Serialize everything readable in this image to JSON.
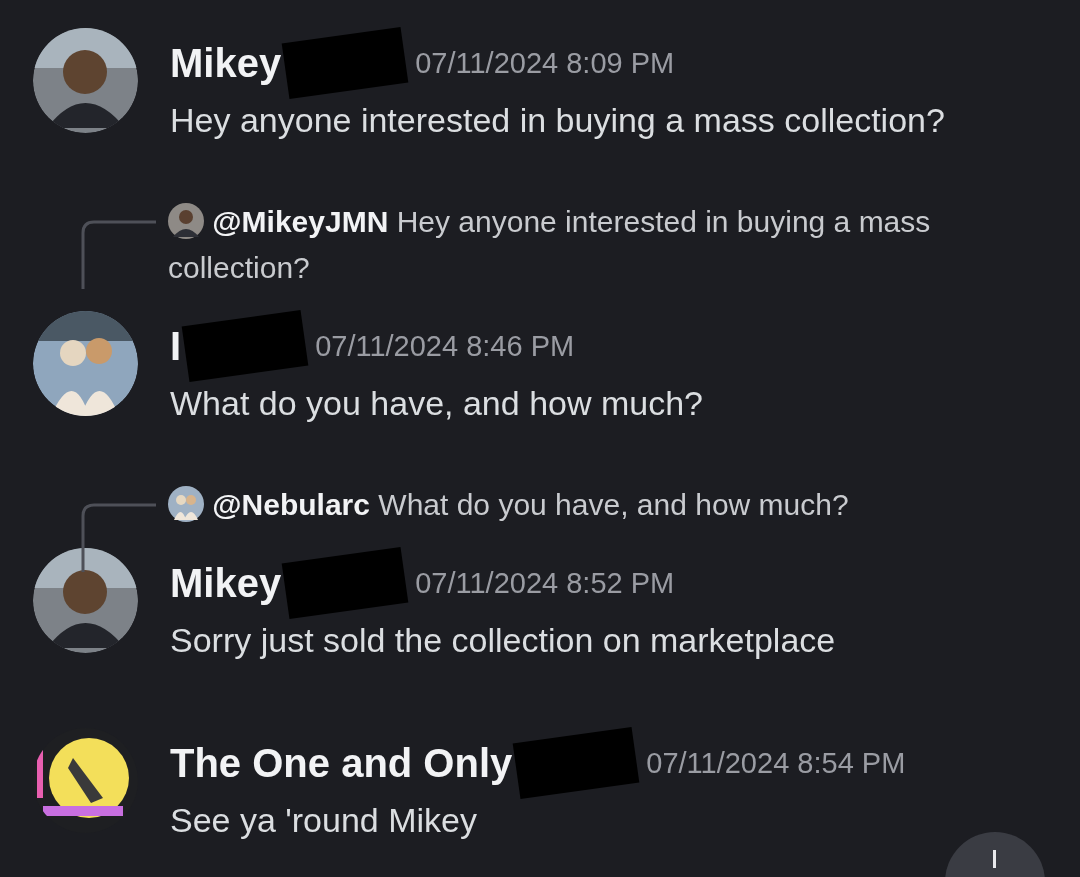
{
  "messages": [
    {
      "author": "Mikey",
      "redacted": true,
      "timestamp": "07/11/2024 8:09 PM",
      "text": "Hey anyone interested in buying a mass collection?",
      "avatar": {
        "kind": "person"
      }
    },
    {
      "reply": {
        "mention": "@MikeyJMN",
        "text": "Hey anyone interested in buying a mass collection?",
        "avatar": {
          "kind": "person"
        }
      },
      "author": "I",
      "redacted": true,
      "timestamp": "07/11/2024 8:46 PM",
      "text": "What do you have, and how much?",
      "avatar": {
        "kind": "couple"
      }
    },
    {
      "reply": {
        "mention": "@Nebularc",
        "text": "What do you have, and how much?",
        "avatar": {
          "kind": "couple"
        }
      },
      "author": "Mikey",
      "redacted": true,
      "timestamp": "07/11/2024 8:52 PM",
      "text": "Sorry just sold the collection on marketplace",
      "avatar": {
        "kind": "person"
      }
    },
    {
      "author": "The One and Only",
      "redacted": true,
      "timestamp": "07/11/2024 8:54 PM",
      "text": "See ya 'round Mikey",
      "avatar": {
        "kind": "art"
      }
    }
  ]
}
